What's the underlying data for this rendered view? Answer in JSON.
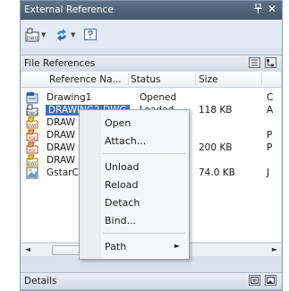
{
  "window": {
    "title": "External Reference",
    "pin_glyph": "&#x1F4CC;",
    "close_glyph": "×"
  },
  "toolbar": {
    "buttons": [
      {
        "name": "attach-dwg-button",
        "icon": "attach-dwg-icon"
      },
      {
        "name": "refresh-button",
        "icon": "refresh-icon"
      },
      {
        "name": "help-button",
        "icon": "help-icon"
      }
    ]
  },
  "file_refs": {
    "header": "File References",
    "columns": [
      "Reference Na...",
      "Status",
      "Size"
    ],
    "rows": [
      {
        "icon": "dwg-file-icon",
        "name": "Drawing1",
        "status": "Opened",
        "size": "",
        "extra": "C"
      },
      {
        "icon": "dwg-xref-icon",
        "name": "DRAWING2.DWG",
        "status": "Loaded",
        "size": "118 KB",
        "extra": "A",
        "selected": true
      },
      {
        "icon": "dwf-icon",
        "name": "DRAW",
        "status": "",
        "size": "",
        "extra": ""
      },
      {
        "icon": "pdf-icon",
        "name": "DRAW",
        "status": "",
        "size": "",
        "extra": "P"
      },
      {
        "icon": "pdf-icon",
        "name": "DRAW",
        "status": "",
        "size": "200 KB",
        "extra": "P"
      },
      {
        "icon": "dwf-icon",
        "name": "DRAW",
        "status": "",
        "size": "",
        "extra": ""
      },
      {
        "icon": "image-icon",
        "name": "GstarC",
        "status": "",
        "size": "74.0 KB",
        "extra": "J"
      }
    ],
    "scroll_thumb_label": "III"
  },
  "context_menu": {
    "items": [
      "Open",
      "Attach...",
      "Unload",
      "Reload",
      "Detach",
      "Bind...",
      "Path"
    ]
  },
  "details": {
    "header": "Details"
  }
}
